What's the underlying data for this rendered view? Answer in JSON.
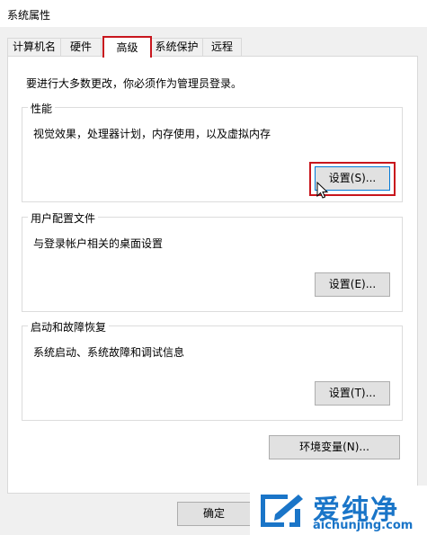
{
  "window": {
    "title": "系统属性"
  },
  "tabs": [
    {
      "label": "计算机名"
    },
    {
      "label": "硬件"
    },
    {
      "label": "高级"
    },
    {
      "label": "系统保护"
    },
    {
      "label": "远程"
    }
  ],
  "active_tab": "高级",
  "intro": "要进行大多数更改，你必须作为管理员登录。",
  "performance": {
    "label": "性能",
    "description": "视觉效果，处理器计划，内存使用，以及虚拟内存",
    "button": "设置(S)..."
  },
  "user_profiles": {
    "label": "用户配置文件",
    "description": "与登录帐户相关的桌面设置",
    "button": "设置(E)..."
  },
  "startup_recovery": {
    "label": "启动和故障恢复",
    "description": "系统启动、系统故障和调试信息",
    "button": "设置(T)..."
  },
  "env_button": "环境变量(N)...",
  "ok_button": "确定",
  "watermark": {
    "cn": "爱纯净",
    "url": "aichunjing.com"
  },
  "colors": {
    "highlight": "#c8161d",
    "watermark": "#1a75c8",
    "focus": "#0078d7"
  }
}
